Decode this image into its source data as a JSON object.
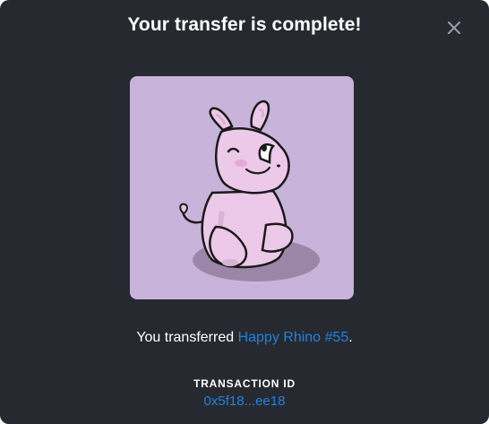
{
  "modal": {
    "title": "Your transfer is complete!",
    "close_icon": "close-icon",
    "nft_image_alt": "Happy Rhino #55"
  },
  "message": {
    "prefix": "You transferred ",
    "item_name": "Happy Rhino #55",
    "suffix": "."
  },
  "transaction": {
    "label": "TRANSACTION ID",
    "id": "0x5f18...ee18"
  },
  "colors": {
    "background": "#262a30",
    "link": "#2081e2",
    "image_background": "#c8b3da",
    "rhino": "#ecc9e8"
  }
}
